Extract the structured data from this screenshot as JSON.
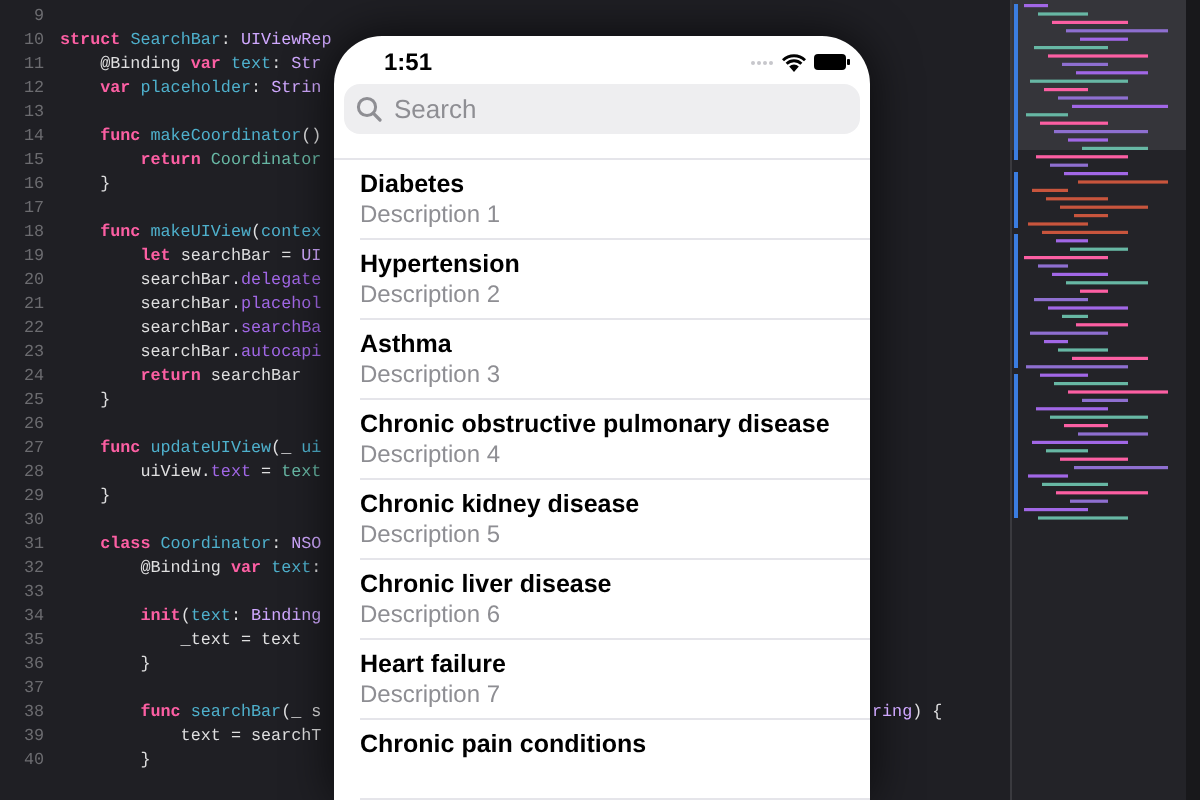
{
  "editor": {
    "lines": [
      {
        "number": "9"
      },
      {
        "number": "10",
        "segments": [
          {
            "text": "struct ",
            "kind": "keyword"
          },
          {
            "text": "SearchBar",
            "kind": "decl"
          },
          {
            "text": ": ",
            "kind": "plain"
          },
          {
            "text": "UIViewRep",
            "kind": "type"
          }
        ]
      },
      {
        "number": "11",
        "segments": [
          {
            "text": "    @Binding ",
            "kind": "plain"
          },
          {
            "text": "var ",
            "kind": "keyword"
          },
          {
            "text": "text",
            "kind": "decl"
          },
          {
            "text": ": ",
            "kind": "plain"
          },
          {
            "text": "Str",
            "kind": "type"
          }
        ]
      },
      {
        "number": "12",
        "segments": [
          {
            "text": "    var ",
            "kind": "keyword"
          },
          {
            "text": "placeholder",
            "kind": "decl"
          },
          {
            "text": ": ",
            "kind": "plain"
          },
          {
            "text": "Strin",
            "kind": "type"
          }
        ]
      },
      {
        "number": "13"
      },
      {
        "number": "14",
        "segments": [
          {
            "text": "    func ",
            "kind": "keyword"
          },
          {
            "text": "makeCoordinator",
            "kind": "decl"
          },
          {
            "text": "()",
            "kind": "plain"
          }
        ]
      },
      {
        "number": "15",
        "segments": [
          {
            "text": "        return ",
            "kind": "keyword"
          },
          {
            "text": "Coordinator",
            "kind": "ref"
          }
        ]
      },
      {
        "number": "16",
        "segments": [
          {
            "text": "    }",
            "kind": "plain"
          }
        ]
      },
      {
        "number": "17"
      },
      {
        "number": "18",
        "segments": [
          {
            "text": "    func ",
            "kind": "keyword"
          },
          {
            "text": "makeUIView",
            "kind": "decl"
          },
          {
            "text": "(",
            "kind": "plain"
          },
          {
            "text": "contex",
            "kind": "decl"
          }
        ]
      },
      {
        "number": "19",
        "segments": [
          {
            "text": "        let ",
            "kind": "keyword"
          },
          {
            "text": "searchBar = ",
            "kind": "plain"
          },
          {
            "text": "UI",
            "kind": "type"
          }
        ]
      },
      {
        "number": "20",
        "segments": [
          {
            "text": "        searchBar.",
            "kind": "plain"
          },
          {
            "text": "delegate",
            "kind": "member"
          }
        ]
      },
      {
        "number": "21",
        "segments": [
          {
            "text": "        searchBar.",
            "kind": "plain"
          },
          {
            "text": "placehol",
            "kind": "member"
          }
        ]
      },
      {
        "number": "22",
        "segments": [
          {
            "text": "        searchBar.",
            "kind": "plain"
          },
          {
            "text": "searchBa",
            "kind": "member"
          }
        ]
      },
      {
        "number": "23",
        "segments": [
          {
            "text": "        searchBar.",
            "kind": "plain"
          },
          {
            "text": "autocapi",
            "kind": "member"
          }
        ]
      },
      {
        "number": "24",
        "segments": [
          {
            "text": "        return ",
            "kind": "keyword"
          },
          {
            "text": "searchBar",
            "kind": "plain"
          }
        ]
      },
      {
        "number": "25",
        "segments": [
          {
            "text": "    }",
            "kind": "plain"
          }
        ]
      },
      {
        "number": "26"
      },
      {
        "number": "27",
        "segments": [
          {
            "text": "    func ",
            "kind": "keyword"
          },
          {
            "text": "updateUIView",
            "kind": "decl"
          },
          {
            "text": "(_ ",
            "kind": "plain"
          },
          {
            "text": "ui",
            "kind": "decl"
          }
        ]
      },
      {
        "number": "28",
        "segments": [
          {
            "text": "        uiView.",
            "kind": "plain"
          },
          {
            "text": "text",
            "kind": "member"
          },
          {
            "text": " = ",
            "kind": "plain"
          },
          {
            "text": "text",
            "kind": "ref"
          }
        ]
      },
      {
        "number": "29",
        "segments": [
          {
            "text": "    }",
            "kind": "plain"
          }
        ]
      },
      {
        "number": "30"
      },
      {
        "number": "31",
        "segments": [
          {
            "text": "    class ",
            "kind": "keyword"
          },
          {
            "text": "Coordinator",
            "kind": "decl"
          },
          {
            "text": ": ",
            "kind": "plain"
          },
          {
            "text": "NSO",
            "kind": "type"
          }
        ]
      },
      {
        "number": "32",
        "segments": [
          {
            "text": "        @Binding ",
            "kind": "plain"
          },
          {
            "text": "var ",
            "kind": "keyword"
          },
          {
            "text": "text",
            "kind": "decl"
          },
          {
            "text": ":",
            "kind": "plain"
          }
        ]
      },
      {
        "number": "33"
      },
      {
        "number": "34",
        "segments": [
          {
            "text": "        init",
            "kind": "keyword"
          },
          {
            "text": "(",
            "kind": "plain"
          },
          {
            "text": "text",
            "kind": "decl"
          },
          {
            "text": ": ",
            "kind": "plain"
          },
          {
            "text": "Binding",
            "kind": "type"
          }
        ]
      },
      {
        "number": "35",
        "segments": [
          {
            "text": "            _text = text",
            "kind": "plain"
          }
        ]
      },
      {
        "number": "36",
        "segments": [
          {
            "text": "        }",
            "kind": "plain"
          }
        ]
      },
      {
        "number": "37"
      },
      {
        "number": "38",
        "segments": [
          {
            "text": "        func ",
            "kind": "keyword"
          },
          {
            "text": "searchBar",
            "kind": "decl"
          },
          {
            "text": "(_ s",
            "kind": "plain"
          }
        ],
        "tail": [
          {
            "text": "ring",
            "kind": "type"
          },
          {
            "text": ") {",
            "kind": "plain"
          }
        ]
      },
      {
        "number": "39",
        "segments": [
          {
            "text": "            text = ",
            "kind": "plain"
          },
          {
            "text": "searchT",
            "kind": "plain"
          }
        ]
      },
      {
        "number": "40",
        "segments": [
          {
            "text": "        }",
            "kind": "plain"
          }
        ]
      }
    ]
  },
  "phone": {
    "time": "1:51",
    "search": {
      "placeholder": "Search"
    },
    "items": [
      {
        "title": "Diabetes",
        "description": "Description 1"
      },
      {
        "title": "Hypertension",
        "description": "Description 2"
      },
      {
        "title": "Asthma",
        "description": "Description 3"
      },
      {
        "title": "Chronic obstructive pulmonary disease",
        "description": "Description 4"
      },
      {
        "title": "Chronic kidney disease",
        "description": "Description 5"
      },
      {
        "title": "Chronic liver disease",
        "description": "Description 6"
      },
      {
        "title": "Heart failure",
        "description": "Description 7"
      },
      {
        "title": "Chronic pain conditions"
      }
    ]
  }
}
